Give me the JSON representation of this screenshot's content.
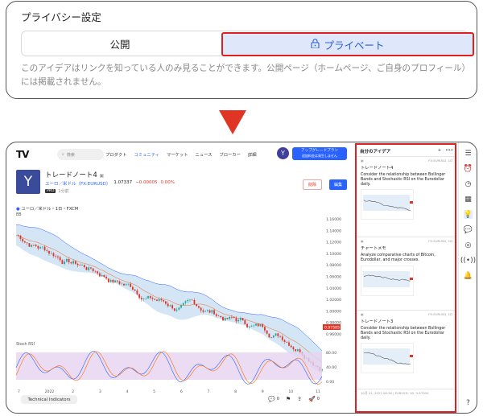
{
  "privacy": {
    "title": "プライバシー設定",
    "public_label": "公開",
    "private_label": "プライベート",
    "description": "このアイデアはリンクを知っている人のみ見ることができます。公開ページ（ホームページ、ご自身のプロフィール）には掲載されません。"
  },
  "app": {
    "logo": "TV",
    "search_placeholder": "検索",
    "nav": [
      "プロダクト",
      "コミュニティ",
      "マーケット",
      "ニュース",
      "ブローカー",
      "詳細"
    ],
    "nav_active_index": 1,
    "avatar_letter": "Y",
    "upgrade_label": "アップグレードプラン",
    "upgrade_sub": "追加料金は発生しません"
  },
  "idea": {
    "avatar_letter": "Y",
    "title": "トレードノート4",
    "symbol": "ユーロ／米ドル（FX:EURUSD）",
    "price": "1.07337",
    "change": "−0.00005",
    "change_pct": "0.00%",
    "badge": "PRO",
    "time": "1分前",
    "delete_label": "削除",
    "publish_label": "編集"
  },
  "chart": {
    "label": "ユーロ／米ドル・1日・FXCM",
    "indicator_bb": "BB",
    "indicator_stoch": "Stoch RSI",
    "price_ticks": [
      "1.16000",
      "1.14000",
      "1.12000",
      "1.10000",
      "1.08000",
      "1.06000",
      "1.04000",
      "1.02000",
      "1.00000",
      "0.98000",
      "0.96000"
    ],
    "current_price": "0.97585",
    "stoch_ticks": [
      "80.00",
      "40.00",
      "0.00"
    ],
    "time_ticks": [
      "7",
      "2022",
      "2",
      "3",
      "4",
      "5",
      "6",
      "7",
      "8",
      "9",
      "10",
      "11"
    ]
  },
  "footer": {
    "tech_indicators": "Technical Indicators",
    "comment_count": "0",
    "boost_count": "0"
  },
  "ideas_panel": {
    "title": "自分のアイデア",
    "cards": [
      {
        "date": "FX:EURUSD, 1D",
        "title": "トレードノート4",
        "text": "Consider the relationship between Bollinger Bands and Stochastic RSI on the Eurodollar daily."
      },
      {
        "date": "FX:EURUSD, 1D",
        "title": "チャートメモ",
        "text": "Analyze comparative charts of Bitcoin, Eurodollar, and major crosses."
      },
      {
        "date": "FX:EURUSD, 1D",
        "title": "トレードノート3",
        "text": "Consider the relationship between Bollinger Bands and Stochastic RSI on the Eurodollar daily."
      }
    ],
    "last_date": "10月 21, 2022 06:36 | EURUSD, 1D, 0.97000"
  },
  "colors": {
    "accent": "#2962ff",
    "highlight": "#e02020",
    "down": "#e03424",
    "up": "#26a69a",
    "bollinger_fill": "#cfe3f5",
    "stoch_fill": "#e6d3f0"
  },
  "rail_icons": [
    "list-icon",
    "alarm-icon",
    "clock-icon",
    "calendar-icon",
    "lightbulb-icon",
    "chat-icon",
    "target-icon",
    "broadcast-icon",
    "bell-icon",
    "help-icon"
  ]
}
